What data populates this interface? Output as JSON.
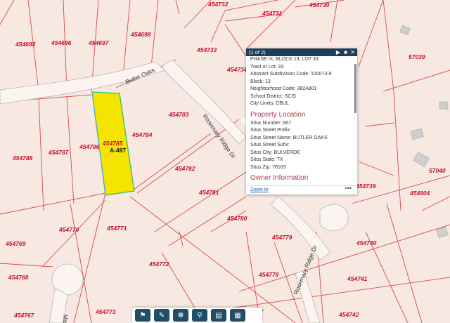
{
  "map": {
    "parcels": [
      "454732",
      "454731",
      "454730",
      "454695",
      "454696",
      "454697",
      "454698",
      "454733",
      "57039",
      "454734",
      "454783",
      "454784",
      "454785",
      "454786",
      "454787",
      "454788",
      "454782",
      "454781",
      "454780",
      "454739",
      "454804",
      "57040",
      "454770",
      "454771",
      "454779",
      "454740",
      "454769",
      "454772",
      "454778",
      "454741",
      "454768",
      "454767",
      "454773",
      "454777",
      "454742"
    ],
    "selected_parcel_tag": "A-497",
    "selected_color": "#f5e400",
    "streets": [
      "Butler Oaks",
      "Rosemary Ridge Dr",
      "Rosemary Ridge Dr",
      "May"
    ]
  },
  "popup": {
    "counter": "(1 of 2)",
    "rows": [
      "PHASE IX, BLOCK 13, LOT 33",
      "Tract or Lot: 33",
      "Abstract Subdivision Code: 100073-9",
      "Block: 13",
      "Neighborhood Code: 382A801",
      "School District: SCIS",
      "City Limits: CBUL"
    ],
    "section_property": "Property Location",
    "property_rows": [
      "Situs Number: 667",
      "Situs Street Prefix:",
      "Situs Street Name: BUTLER OAKS",
      "Situs Street Sufix:",
      "Situs City: BULVERDE",
      "Situs State: TX",
      "Situs Zip: 78163"
    ],
    "section_owner": "Owner Information",
    "zoom_to": "Zoom to",
    "more": "•••",
    "header_color": "#1e3d5a"
  },
  "toolbar": {
    "tools": [
      "bookmark-icon",
      "measure-icon",
      "layers-icon",
      "search-icon",
      "print-icon",
      "basemap-icon"
    ]
  }
}
